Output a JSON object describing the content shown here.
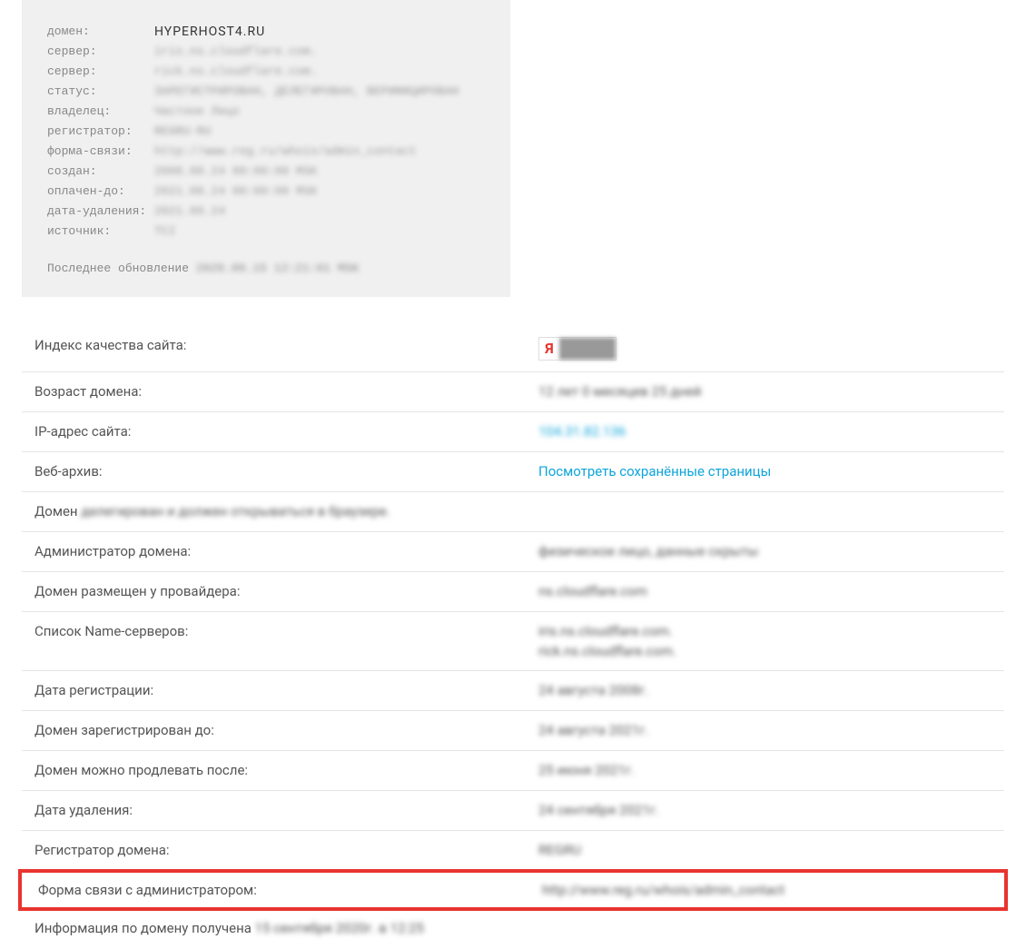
{
  "whois": {
    "rows": [
      {
        "label": "домен:",
        "value": "HYPERHOST4.RU",
        "clear": true
      },
      {
        "label": "сервер:",
        "value": "iris.ns.cloudflare.com."
      },
      {
        "label": "сервер:",
        "value": "rick.ns.cloudflare.com."
      },
      {
        "label": "статус:",
        "value": "ЗАРЕГИСТРИРОВАН, ДЕЛЕГИРОВАН, ВЕРИФИЦИРОВАН"
      },
      {
        "label": "владелец:",
        "value": "Частное Лицо"
      },
      {
        "label": "регистратор:",
        "value": "REGRU-RU"
      },
      {
        "label": "форма-связи:",
        "value": "http://www.reg.ru/whois/admin_contact"
      },
      {
        "label": "создан:",
        "value": "2008.08.24 00:00:00 MSK"
      },
      {
        "label": "оплачен-до:",
        "value": "2021.08.24 00:00:00 MSK"
      },
      {
        "label": "дата-удаления:",
        "value": "2021.09.24"
      },
      {
        "label": "источник:",
        "value": "TCI"
      }
    ],
    "footer_prefix": "Последнее обновление ",
    "footer_value": "2020.09.15 12:21:01 MSK"
  },
  "info": [
    {
      "label": "Индекс качества сайта:",
      "type": "badge",
      "yandex_letter": "Я"
    },
    {
      "label": "Возраст домена:",
      "value": "12 лет 0 месяцев 25 дней",
      "blurred": true
    },
    {
      "label": "IP-адрес сайта:",
      "value": "104.31.82.136",
      "link": true,
      "blurred": true
    },
    {
      "label": "Веб-архив:",
      "value": "Посмотреть сохранённые страницы",
      "link": true,
      "blurred": false
    },
    {
      "label_prefix": "Домен ",
      "label_blur": "делегирован и должен открываться в браузере.",
      "full_row": true
    },
    {
      "label": "Администратор домена:",
      "value": "физическое лицо, данные скрыты",
      "blurred": true
    },
    {
      "label": "Домен размещен у провайдера:",
      "value": "ns.cloudflare.com",
      "blurred": true
    },
    {
      "label": "Список Name-серверов:",
      "values": [
        "iris.ns.cloudflare.com.",
        "rick.ns.cloudflare.com."
      ],
      "blurred": true
    },
    {
      "label": "Дата регистрации:",
      "value": "24 августа 2008г.",
      "blurred": true
    },
    {
      "label": "Домен зарегистрирован до:",
      "value": "24 августа 2021г.",
      "blurred": true
    },
    {
      "label": "Домен можно продлевать после:",
      "value": "25 июня 2021г.",
      "blurred": true
    },
    {
      "label": "Дата удаления:",
      "value": "24 сентября 2021г.",
      "blurred": true
    },
    {
      "label": "Регистратор домена:",
      "value": "REGRU",
      "blurred": true
    },
    {
      "label": "Форма связи с администратором:",
      "value": "http://www.reg.ru/whois/admin_contact",
      "blurred": true,
      "highlighted": true
    },
    {
      "label_prefix": "Информация по домену получена ",
      "label_blur": "15 сентября 2020г. в 12:25",
      "full_row": true,
      "no_border": true
    }
  ]
}
